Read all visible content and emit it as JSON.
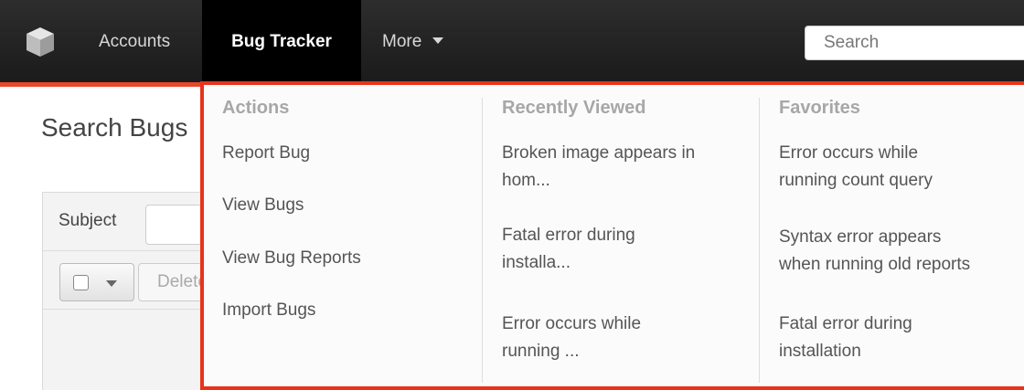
{
  "navbar": {
    "logo_icon": "cube-logo-icon",
    "items": [
      {
        "label": "Accounts"
      },
      {
        "label": "Bug Tracker",
        "active": true
      },
      {
        "label": "More"
      }
    ],
    "search_placeholder": "Search",
    "accent_color": "#e8331b"
  },
  "page": {
    "title": "Search Bugs",
    "subject_label": "Subject",
    "delete_label": "Delete"
  },
  "dropdown": {
    "actions": {
      "heading": "Actions",
      "items": [
        "Report Bug",
        "View Bugs",
        "View Bug Reports",
        "Import Bugs"
      ]
    },
    "recently_viewed": {
      "heading": "Recently Viewed",
      "items": [
        {
          "line1": "Broken image appears in",
          "line2": "hom..."
        },
        {
          "line1": "Fatal error during",
          "line2": "installa..."
        },
        {
          "line1": "Error occurs while",
          "line2": "running ..."
        }
      ]
    },
    "favorites": {
      "heading": "Favorites",
      "items": [
        {
          "line1": "Error occurs while",
          "line2": "running count query"
        },
        {
          "line1": "Syntax error appears",
          "line2": "when running old reports"
        },
        {
          "line1": "Fatal error during",
          "line2": "installation"
        }
      ]
    }
  }
}
